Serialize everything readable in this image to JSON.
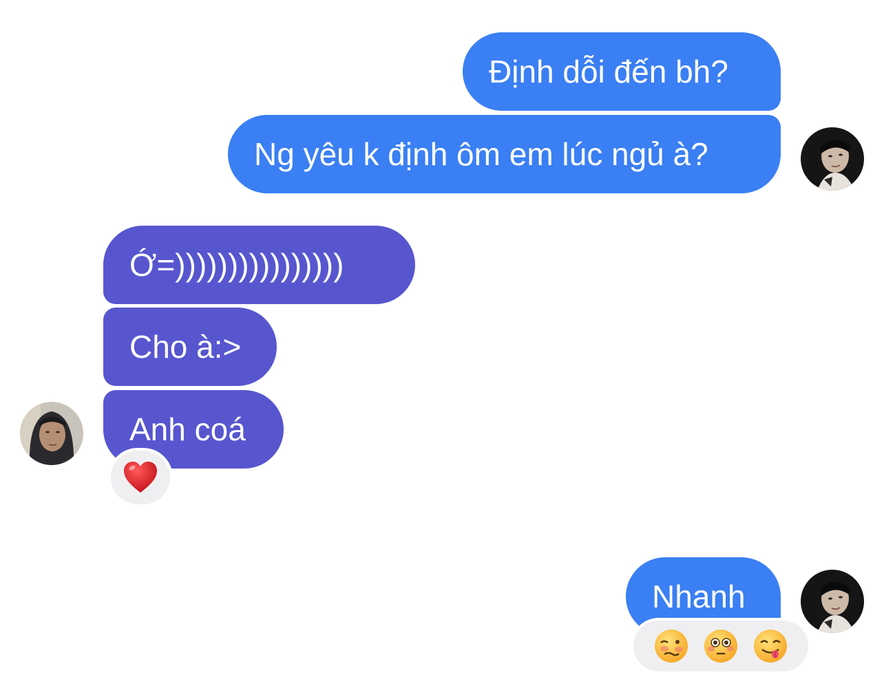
{
  "messages": [
    {
      "id": "m1",
      "direction": "outgoing",
      "text": "Định dỗi đến bh?"
    },
    {
      "id": "m2",
      "direction": "outgoing",
      "text": "Ng yêu k định ôm em lúc ngủ à?"
    },
    {
      "id": "m3",
      "direction": "incoming",
      "text": "Ớ=))))))))))))))))"
    },
    {
      "id": "m4",
      "direction": "incoming",
      "text": "Cho à:>"
    },
    {
      "id": "m5",
      "direction": "incoming",
      "text": "Anh coá"
    },
    {
      "id": "m6",
      "direction": "outgoing",
      "text": "Nhanh"
    }
  ],
  "reactions": {
    "m5": [
      "red-heart"
    ],
    "m6": [
      "woozy-face",
      "flushed-face",
      "face-savoring-food"
    ]
  },
  "colors": {
    "outgoing_bubble": "#3a7ff3",
    "incoming_bubble": "#5756cf",
    "reaction_pill": "#efeff1",
    "background": "#ffffff"
  }
}
